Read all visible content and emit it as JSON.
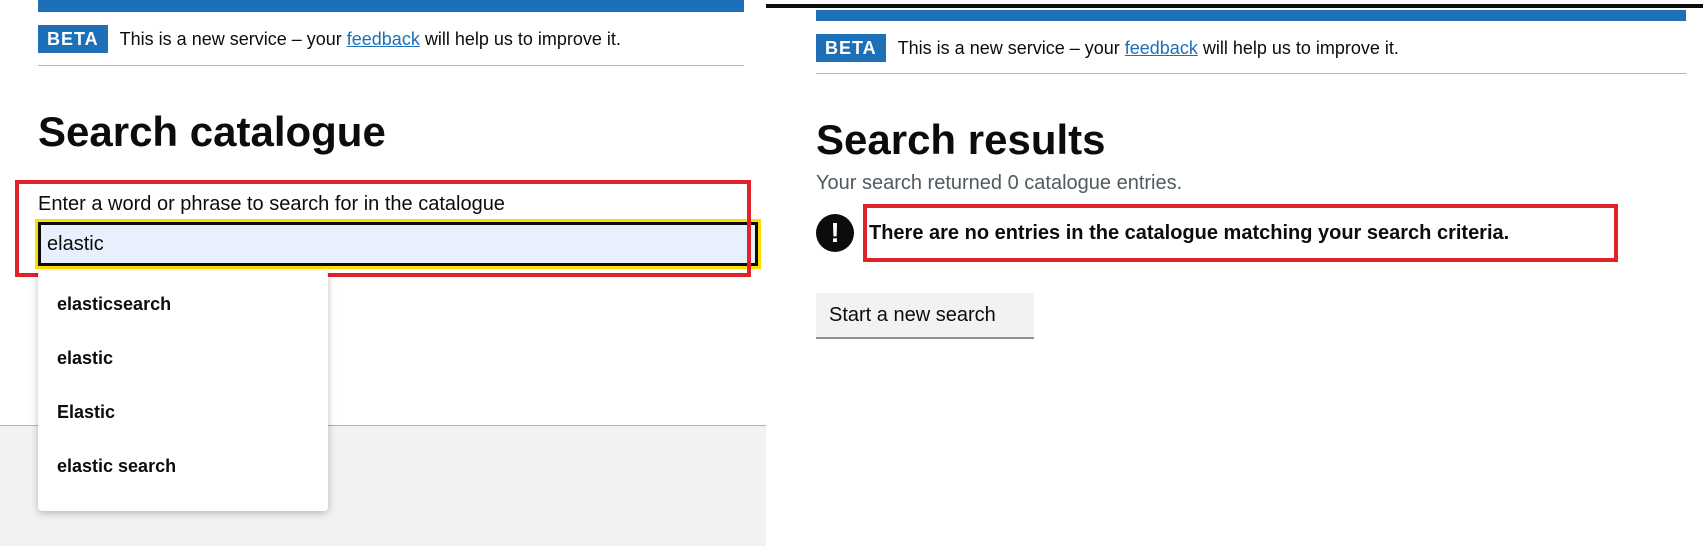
{
  "left": {
    "beta_tag": "BETA",
    "beta_text_before": "This is a new service – your ",
    "beta_link": "feedback",
    "beta_text_after": " will help us to improve it.",
    "title": "Search catalogue",
    "search_label": "Enter a word or phrase to search for in the catalogue",
    "search_value": "elastic",
    "suggestions": [
      "elasticsearch",
      "elastic",
      "Elastic",
      "elastic search"
    ]
  },
  "right": {
    "beta_tag": "BETA",
    "beta_text_before": "This is a new service – your ",
    "beta_link": "feedback",
    "beta_text_after": " will help us to improve it.",
    "title": "Search results",
    "summary": "Your search returned 0 catalogue entries.",
    "warning_icon": "!",
    "warning_text": "There are no entries in the catalogue matching your search criteria.",
    "new_search_label": "Start a new search"
  },
  "colors": {
    "brand_blue": "#1d70b8",
    "highlight_red": "#e0222a",
    "focus_yellow": "#ffdd00"
  }
}
